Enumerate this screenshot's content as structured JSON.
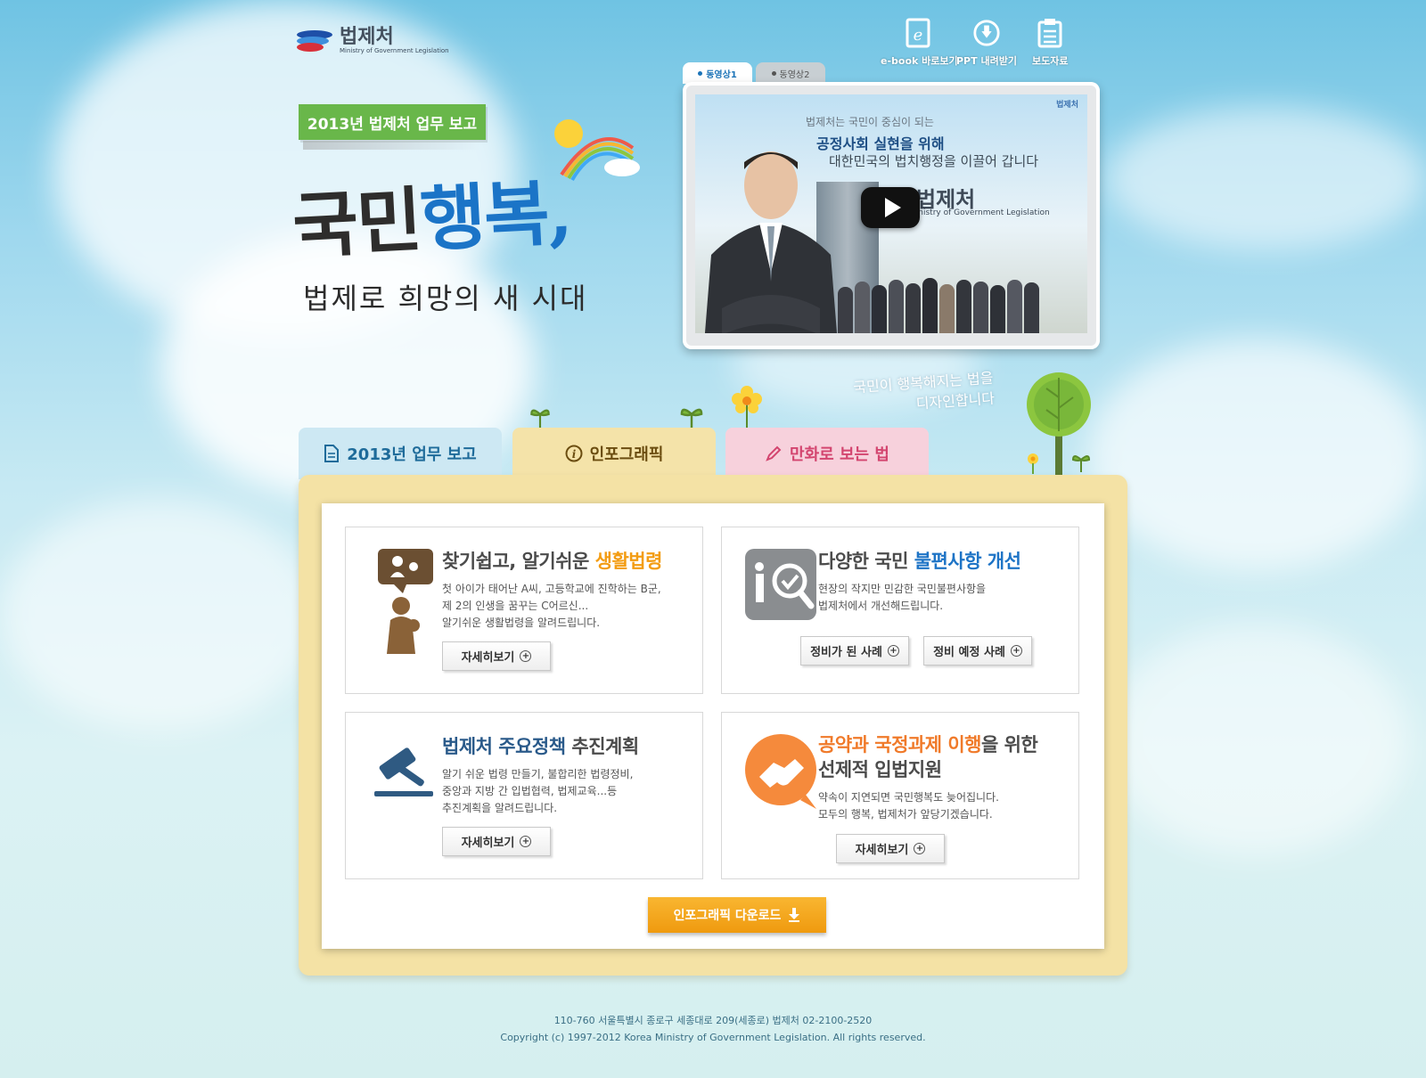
{
  "header": {
    "logo_ko": "법제처",
    "logo_en": "Ministry of Government Legislation",
    "utilities": [
      {
        "label": "e-book 바로보기",
        "icon": "ebook-icon"
      },
      {
        "label": "PPT 내려받기",
        "icon": "download-icon"
      },
      {
        "label": "보도자료",
        "icon": "clipboard-icon"
      }
    ]
  },
  "hero": {
    "badge": "2013년 법제처 업무 보고",
    "title_part1": "국민",
    "title_part2": "행복,",
    "subtitle": "법제로 희망의 새 시대"
  },
  "video": {
    "tabs": [
      "동영상1",
      "동영상2"
    ],
    "line1": "법제처는 국민이 중심이 되는",
    "line2": "공정사회 실현을 위해",
    "line3": "대한민국의 법치행정을 이끌어 갑니다",
    "brand_ko": "법제처",
    "brand_en": "Ministry of Government Legislation",
    "corner_brand": "법제처"
  },
  "slogan": {
    "line1": "국민이 행복해지는 법을",
    "line2": "디자인합니다"
  },
  "tabs": {
    "plan": "2013년 업무 보고",
    "info": "인포그래픽",
    "comic": "만화로 보는 법"
  },
  "cards": {
    "c1": {
      "title_a": "찾기쉽고, 알기쉬운 ",
      "title_b": "생활법령",
      "desc": [
        "첫 아이가 태어난 A씨, 고등학교에 진학하는 B군,",
        "제 2의 인생을 꿈꾸는 C어르신...",
        "알기쉬운 생활법령을 알려드립니다."
      ],
      "button": "자세히보기"
    },
    "c2": {
      "title_a": "다양한 국민 ",
      "title_b": "불편사항 개선",
      "desc": [
        "현장의 작지만 민감한 국민불편사항을",
        "법제처에서 개선해드립니다."
      ],
      "button1": "정비가 된 사례",
      "button2": "정비 예정 사례"
    },
    "c3": {
      "title_a": "법제처 주요정책 ",
      "title_b": "추진계획",
      "desc": [
        "알기 쉬운 법령 만들기, 불합리한 법령정비,",
        "중앙과 지방 간 입법협력, 법제교육...등",
        "추진계획을 알려드립니다."
      ],
      "button": "자세히보기"
    },
    "c4": {
      "title_a": "공약과 국정과제 이행",
      "title_b": "을 위한",
      "title_c": "선제적 입법지원",
      "desc": [
        "약속이 지연되면 국민행복도 늦어집니다.",
        "모두의 행복, 법제처가 앞당기겠습니다."
      ],
      "button": "자세히보기"
    }
  },
  "download": "인포그래픽 다운로드",
  "footer": {
    "address": "110-760 서울특별시 종로구 세종대로 209(세종로) 법제처 02-2100-2520",
    "copyright": "Copyright (c) 1997-2012 Korea Ministry of Government Legislation. All rights reserved."
  },
  "colors": {
    "accent_blue": "#1e74c6",
    "accent_orange": "#f39c12",
    "badge_green": "#69b74a",
    "panel_yellow": "#f4e2a5"
  }
}
